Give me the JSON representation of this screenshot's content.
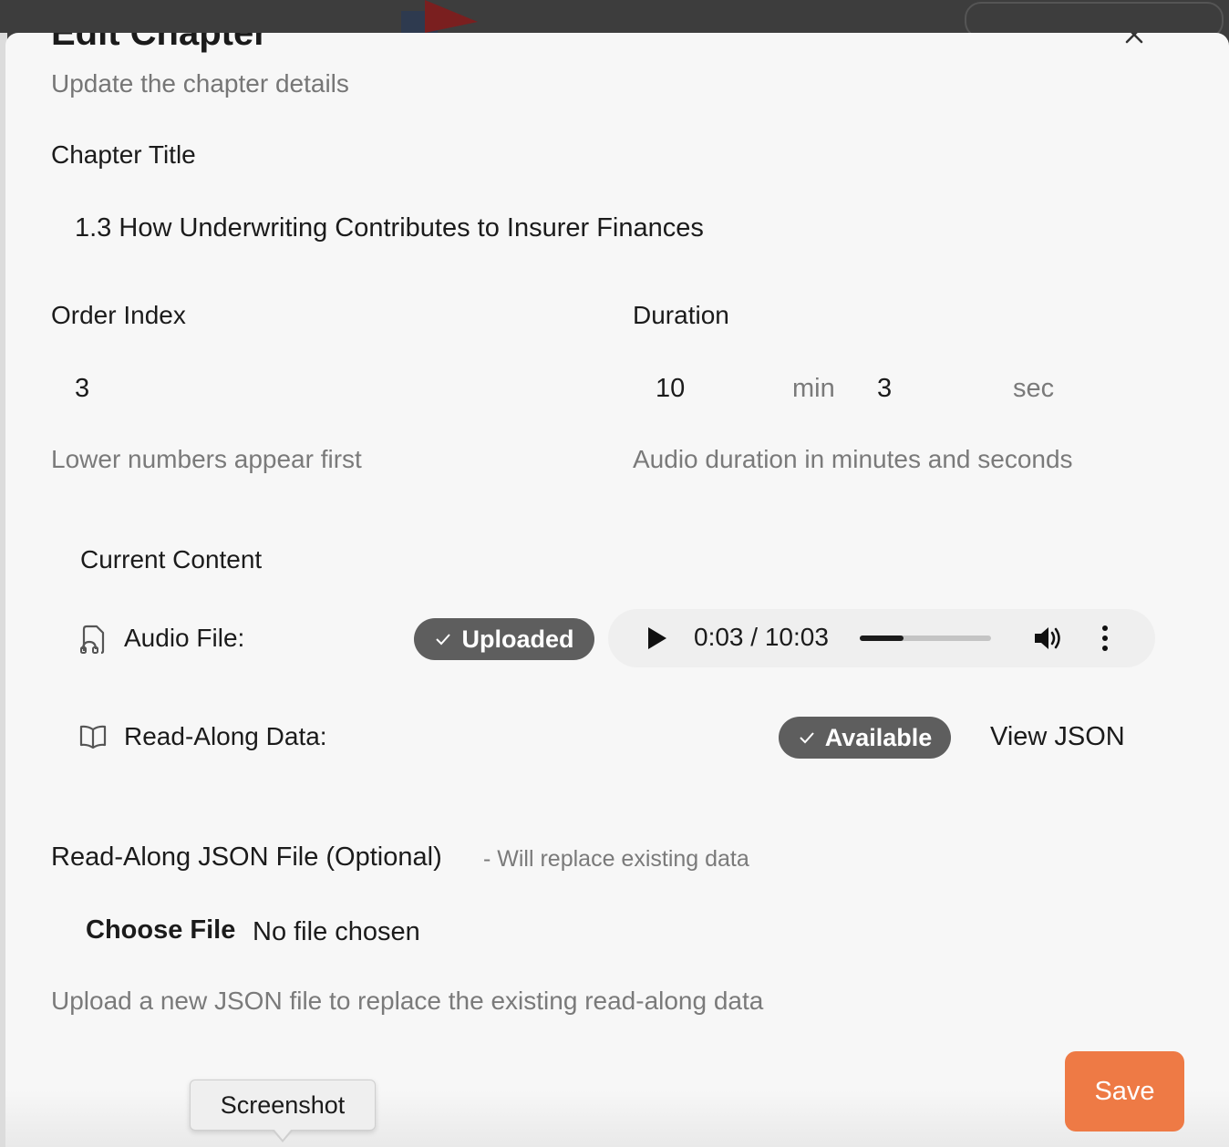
{
  "dialog": {
    "title": "Edit Chapter",
    "subtitle": "Update the chapter details"
  },
  "chapter_title": {
    "label": "Chapter Title",
    "value": "1.3 How Underwriting Contributes to Insurer Finances"
  },
  "order_index": {
    "label": "Order Index",
    "value": "3",
    "hint": "Lower numbers appear first"
  },
  "duration": {
    "label": "Duration",
    "minutes": "10",
    "minutes_unit": "min",
    "seconds": "3",
    "seconds_unit": "sec",
    "hint": "Audio duration in minutes and seconds"
  },
  "current_content": {
    "heading": "Current Content",
    "audio": {
      "label": "Audio File:",
      "badge": "Uploaded",
      "icon": "audio-file-icon",
      "player": {
        "time": "0:03 / 10:03",
        "progress": 0.33
      }
    },
    "read_along": {
      "label": "Read-Along Data:",
      "badge": "Available",
      "icon": "book-open-icon",
      "link": "View JSON"
    }
  },
  "json_upload": {
    "label": "Read-Along JSON File (Optional)",
    "note": "- Will replace existing data",
    "button": "Choose File",
    "status": "No file chosen",
    "hint": "Upload a new JSON file to replace the existing read-along data"
  },
  "actions": {
    "save": "Save"
  },
  "tooltip": {
    "text": "Screenshot"
  },
  "colors": {
    "accent": "#ee7a45",
    "badge": "#5e5e5e",
    "muted_text": "#7a7a7a"
  }
}
